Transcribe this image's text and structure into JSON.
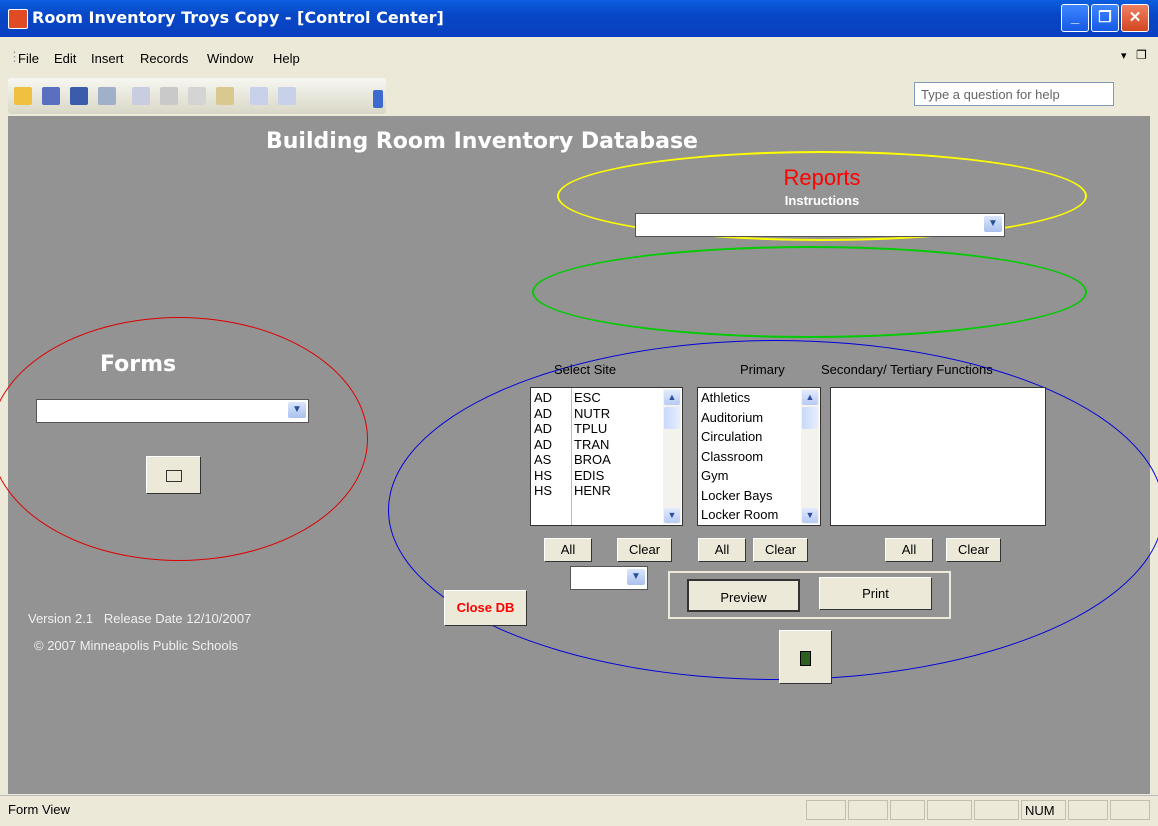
{
  "window": {
    "title": "Room Inventory Troys Copy - [Control Center]"
  },
  "menu": {
    "items": [
      "File",
      "Edit",
      "Insert",
      "Records",
      "Window",
      "Help"
    ],
    "help_placeholder": "Type a question for help"
  },
  "form": {
    "title": "Building Room Inventory Database",
    "reports_label": "Reports",
    "instructions_label": "Instructions",
    "forms_label": "Forms",
    "select_site_label": "Select Site",
    "primary_label": "Primary",
    "secondary_label": "Secondary/ Tertiary Functions",
    "sites": [
      {
        "code": "AD",
        "name": "ESC"
      },
      {
        "code": "AD",
        "name": "NUTR"
      },
      {
        "code": "AD",
        "name": "TPLU"
      },
      {
        "code": "AD",
        "name": "TRAN"
      },
      {
        "code": "AS",
        "name": "BROA"
      },
      {
        "code": "HS",
        "name": "EDIS"
      },
      {
        "code": "HS",
        "name": "HENR"
      }
    ],
    "primary_items": [
      "Athletics",
      "Auditorium",
      "Circulation",
      "Classroom",
      "Gym",
      "Locker Bays",
      "Locker Room"
    ],
    "all_label": "All",
    "clear_label": "Clear",
    "preview_label": "Preview",
    "print_label": "Print",
    "close_db_label": "Close DB",
    "version_text": "Version 2.1   Release Date 12/10/2007",
    "copyright_text": "© 2007 Minneapolis Public Schools",
    "colors": {
      "reports_text": "#ff0000",
      "close_db_text": "#ff0000",
      "reports_ellipse": "#ffff00",
      "green_ellipse": "#00cc00",
      "forms_ellipse": "#dd0000",
      "site_ellipse": "#0000dd",
      "form_bg": "#939393"
    }
  },
  "status": {
    "left_text": "Form View",
    "num_text": "NUM"
  }
}
